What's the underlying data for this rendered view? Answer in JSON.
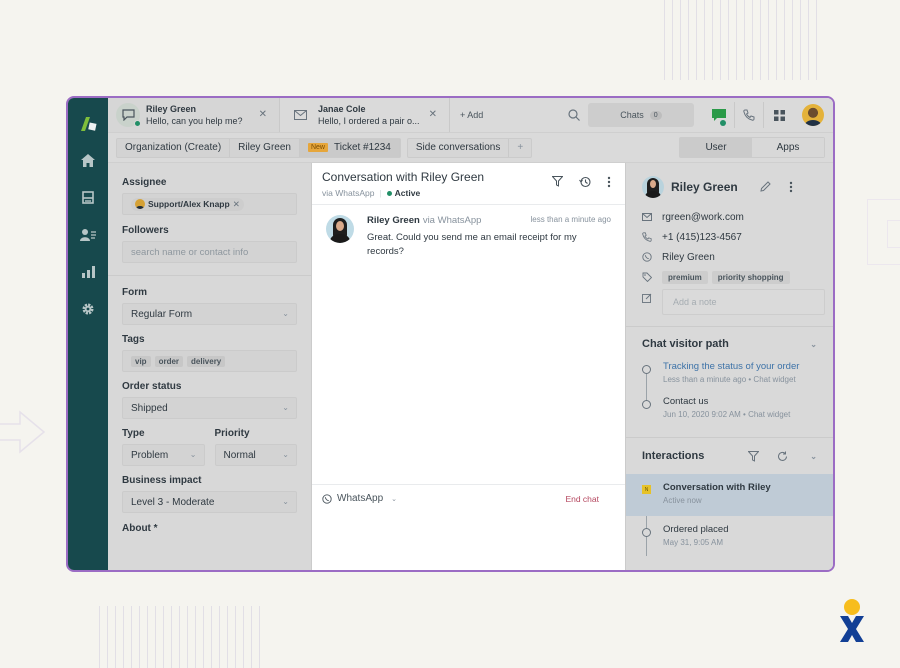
{
  "tabs": [
    {
      "name": "Riley Green",
      "preview": "Hello, can you help me?",
      "icon": "chat-bubble-icon",
      "active": true
    },
    {
      "name": "Janae Cole",
      "preview": "Hello, I ordered a pair o...",
      "icon": "envelope-icon",
      "active": false
    }
  ],
  "topbar": {
    "add_label": "+ Add",
    "chats_label": "Chats",
    "chats_count": "0"
  },
  "breadcrumbs": {
    "organization": "Organization (Create)",
    "user": "Riley Green",
    "new_badge": "New",
    "ticket": "Ticket #1234",
    "side_conversations": "Side conversations",
    "plus": "+"
  },
  "panel_switch": {
    "user": "User",
    "apps": "Apps"
  },
  "ticket_fields": {
    "assignee_label": "Assignee",
    "assignee_value": "Support/Alex Knapp",
    "followers_label": "Followers",
    "followers_placeholder": "search name or contact info",
    "form_label": "Form",
    "form_value": "Regular Form",
    "tags_label": "Tags",
    "tags": [
      "vip",
      "order",
      "delivery"
    ],
    "order_status_label": "Order status",
    "order_status_value": "Shipped",
    "type_label": "Type",
    "type_value": "Problem",
    "priority_label": "Priority",
    "priority_value": "Normal",
    "business_impact_label": "Business impact",
    "business_impact_value": "Level 3 - Moderate",
    "about_label": "About *"
  },
  "conversation": {
    "title": "Conversation with Riley Green",
    "via": "via WhatsApp",
    "status": "Active",
    "message": {
      "author": "Riley Green",
      "via": "via WhatsApp",
      "time": "less than a minute ago",
      "text": "Great. Could you send me an email receipt for my records?"
    },
    "channel": "WhatsApp",
    "end_chat": "End chat"
  },
  "user_panel": {
    "name": "Riley Green",
    "email": "rgreen@work.com",
    "phone": "+1 (415)123-4567",
    "whatsapp": "Riley Green",
    "tags": [
      "premium",
      "priority shopping"
    ],
    "note_placeholder": "Add a note"
  },
  "visitor_path": {
    "title": "Chat visitor path",
    "items": [
      {
        "title": "Tracking the status of your order",
        "meta": "Less than a minute ago • Chat widget",
        "link": true
      },
      {
        "title": "Contact us",
        "meta": "Jun 10, 2020 9:02 AM • Chat widget",
        "link": false
      }
    ]
  },
  "interactions": {
    "title": "Interactions",
    "items": [
      {
        "badge": "N",
        "title": "Conversation with Riley",
        "meta": "Active now",
        "selected": true
      },
      {
        "title": "Ordered placed",
        "meta": "May 31, 9:05 AM",
        "selected": false
      }
    ]
  },
  "colors": {
    "accent_green": "#228f67",
    "rail": "#17494d",
    "window_border": "#9b6cc4",
    "link": "#3e73a8",
    "end_chat": "#b5475f",
    "new_badge": "#e6a63b"
  }
}
